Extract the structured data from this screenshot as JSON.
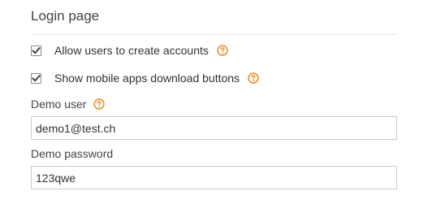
{
  "section": {
    "title": "Login page"
  },
  "options": [
    {
      "label": "Allow users to create accounts",
      "checked": true,
      "help_icon": "question-circle-icon"
    },
    {
      "label": "Show mobile apps download buttons",
      "checked": true,
      "help_icon": "question-circle-icon"
    }
  ],
  "demo_user": {
    "label": "Demo user",
    "help_icon": "question-circle-icon",
    "value": "demo1@test.ch"
  },
  "demo_password": {
    "label": "Demo password",
    "value": "123qwe"
  },
  "colors": {
    "help_icon": "#e8912d",
    "checkmark": "#333333",
    "input_border": "#cccccc",
    "divider": "#e6e6e6"
  }
}
